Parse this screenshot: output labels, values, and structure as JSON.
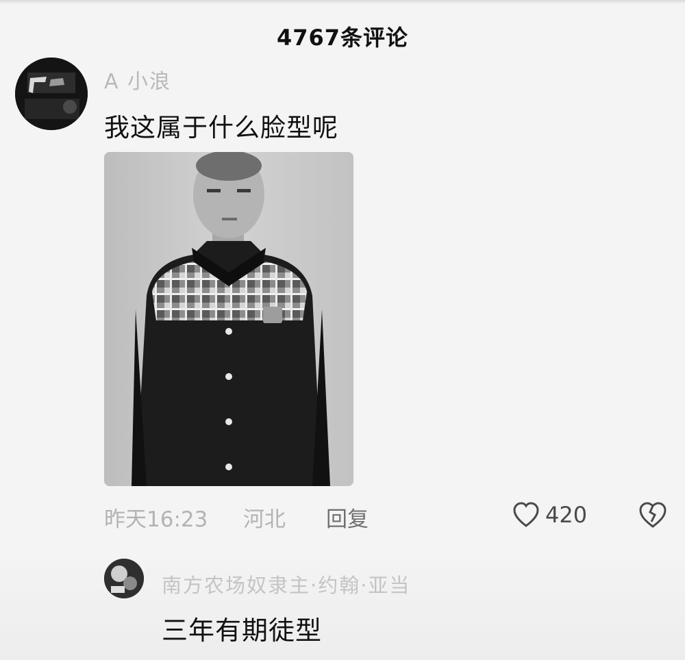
{
  "header": {
    "title": "4767条评论"
  },
  "comment": {
    "username": "A  小浪",
    "text": "我这属于什么脸型呢",
    "time": "昨天16:23",
    "location": "河北",
    "reply_label": "回复",
    "like_count": "420",
    "icons": {
      "like": "heart-icon",
      "dislike": "broken-heart-icon"
    }
  },
  "reply": {
    "username": "南方农场奴隶主·约翰·亚当",
    "text": "三年有期徒型"
  },
  "colors": {
    "background": "#f4f4f4",
    "text": "#111111",
    "muted": "#b3b3b3"
  }
}
